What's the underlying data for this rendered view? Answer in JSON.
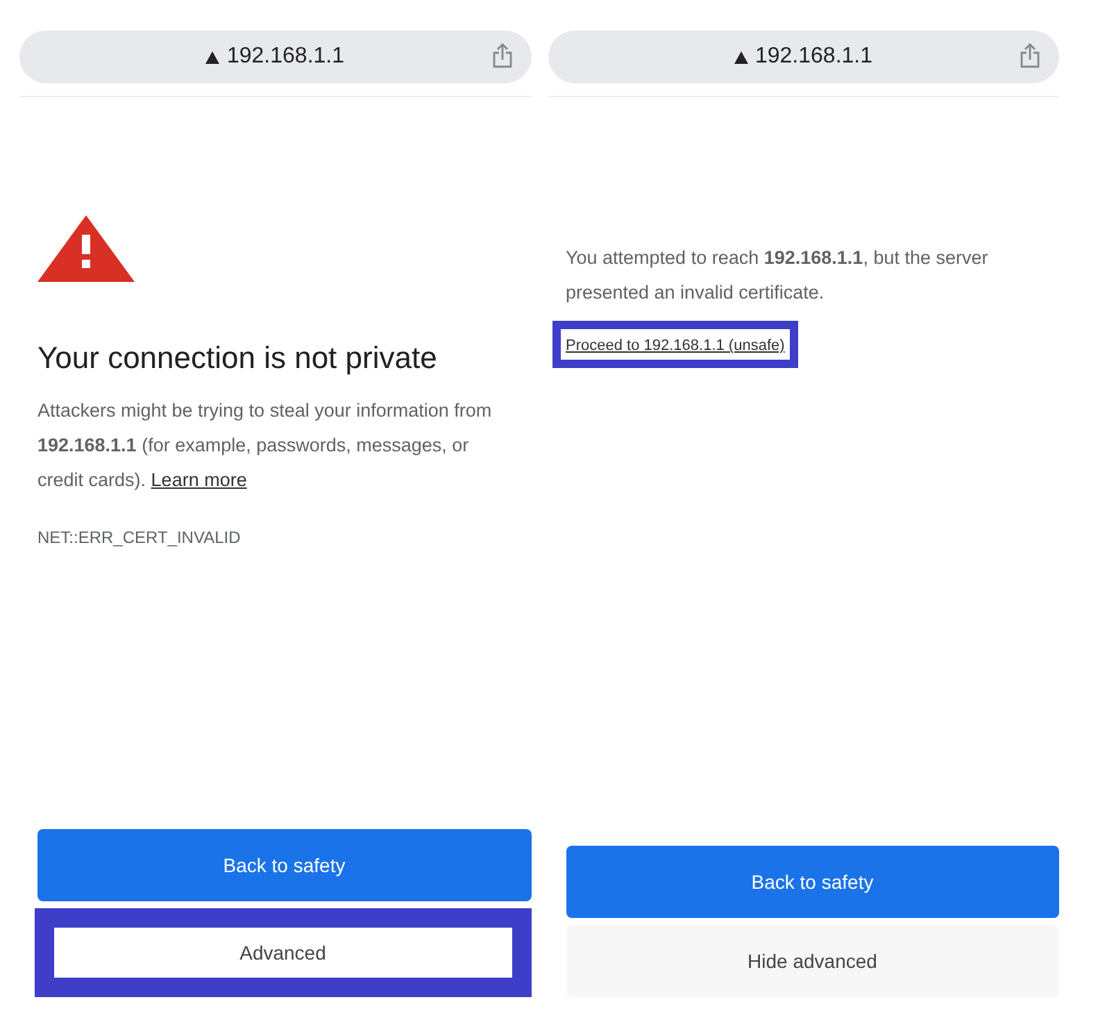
{
  "panels": [
    {
      "address_bar": {
        "url": "192.168.1.1"
      },
      "content": {
        "kind": "warning",
        "title": "Your connection is not private",
        "description": "Attackers might be trying to steal your information from **192.168.1.1** (for example, passwords, messages, or credit cards).",
        "link": {
          "label": "Learn more",
          "highlighted": false
        },
        "error_code": "NET::ERR_CERT_INVALID"
      },
      "buttons": [
        {
          "label": "Back to safety",
          "kind": "primary",
          "highlighted": false
        },
        {
          "label": "Advanced",
          "kind": "secondary",
          "highlighted": true
        }
      ]
    },
    {
      "address_bar": {
        "url": "192.168.1.1"
      },
      "content": {
        "kind": "details",
        "description": "You attempted to reach **192.168.1.1**, but the server presented an invalid certificate.",
        "link": {
          "label": "Proceed to 192.168.1.1 (unsafe)",
          "highlighted": true
        }
      },
      "buttons": [
        {
          "label": "Back to safety",
          "kind": "primary",
          "highlighted": false
        },
        {
          "label": "Hide advanced",
          "kind": "secondary",
          "highlighted": false
        }
      ]
    }
  ]
}
